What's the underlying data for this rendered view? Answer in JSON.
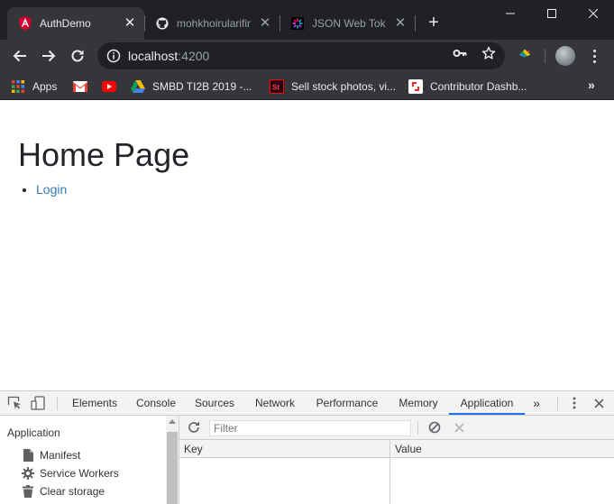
{
  "tabs": [
    {
      "title": "AuthDemo",
      "icon": "angular-icon",
      "active": true
    },
    {
      "title": "mohkhoirularifin",
      "icon": "github-icon",
      "active": false
    },
    {
      "title": "JSON Web Tokens",
      "icon": "jwt-icon",
      "active": false
    }
  ],
  "omnibox": {
    "host": "localhost",
    "port": ":4200"
  },
  "bookmarks": [
    {
      "label": "Apps",
      "icon": "apps-grid-icon"
    },
    {
      "label": "",
      "icon": "gmail-icon"
    },
    {
      "label": "",
      "icon": "youtube-icon"
    },
    {
      "label": "SMBD TI2B 2019 -...",
      "icon": "google-drive-icon"
    },
    {
      "label": "Sell stock photos, vi...",
      "icon": "adobe-stock-icon"
    },
    {
      "label": "Contributor Dashb...",
      "icon": "shutterstock-icon"
    }
  ],
  "page": {
    "heading": "Home Page",
    "links": [
      "Login"
    ]
  },
  "devtools": {
    "tabs": [
      "Elements",
      "Console",
      "Sources",
      "Network",
      "Performance",
      "Memory",
      "Application"
    ],
    "active_tab": "Application",
    "more": "»",
    "sidebar": {
      "header": "Application",
      "items": [
        {
          "label": "Manifest",
          "icon": "file-icon"
        },
        {
          "label": "Service Workers",
          "icon": "gear-icon"
        },
        {
          "label": "Clear storage",
          "icon": "trash-icon"
        }
      ]
    },
    "filter_placeholder": "Filter",
    "columns": {
      "key": "Key",
      "value": "Value"
    }
  },
  "colors": {
    "accent": "#1a73e8",
    "link": "#337ab7",
    "chrome_dark": "#202124",
    "chrome_toolbar": "#35363a"
  }
}
